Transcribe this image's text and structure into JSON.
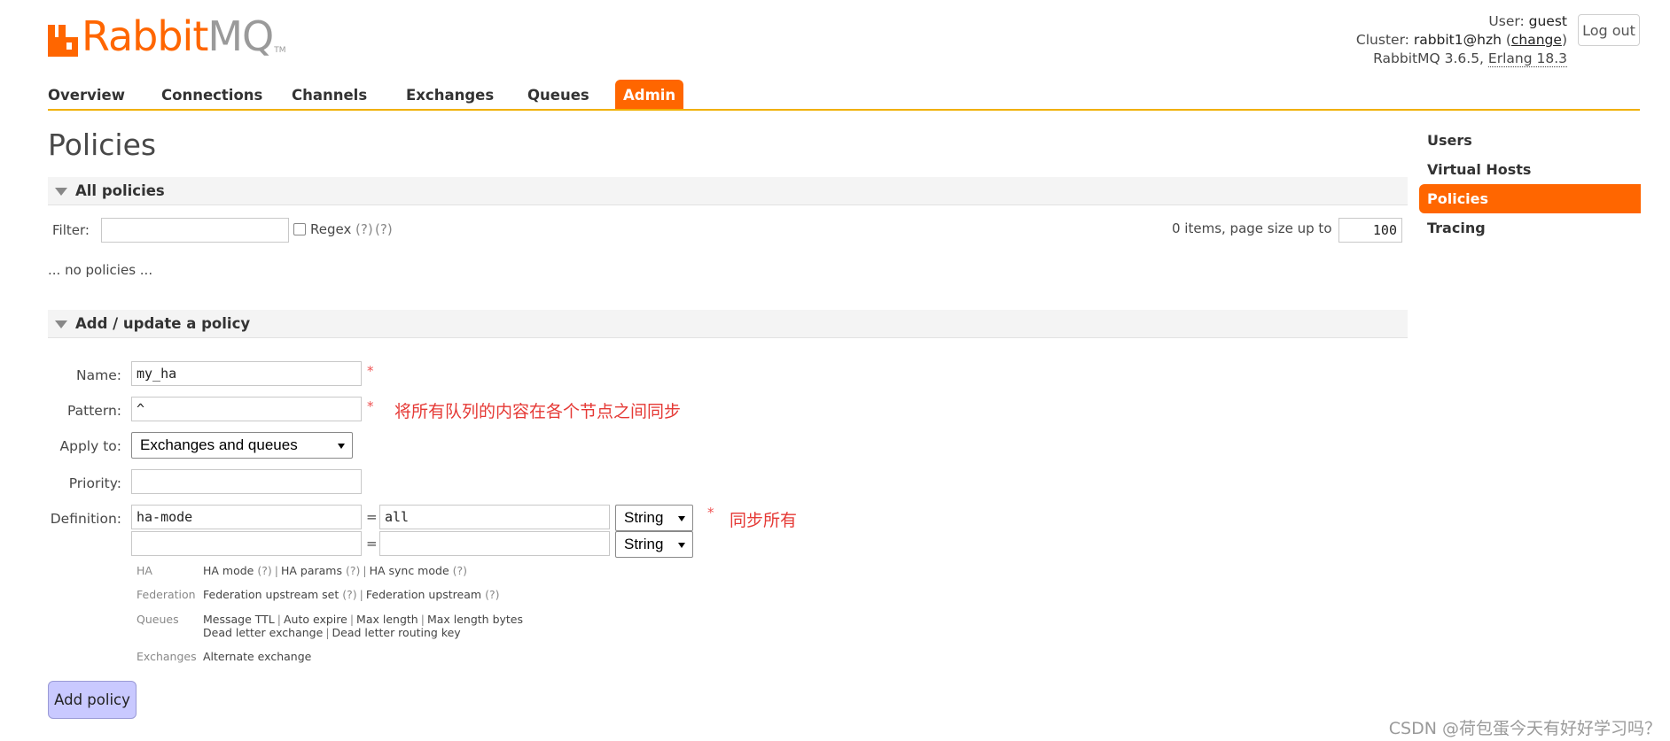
{
  "brand": {
    "name_part1": "Rabbit",
    "name_part2": "MQ",
    "trademark": "TM",
    "color_primary": "#ff6600",
    "color_secondary": "#9a9a9a"
  },
  "login": {
    "user_label": "User:",
    "user_value": "guest",
    "cluster_label": "Cluster:",
    "cluster_value": "rabbit1@hzh",
    "cluster_change_link": "change",
    "version_text": "RabbitMQ 3.6.5,",
    "erlang_link": "Erlang 18.3",
    "logout_label": "Log out"
  },
  "tabs": [
    {
      "label": "Overview",
      "active": false
    },
    {
      "label": "Connections",
      "active": false
    },
    {
      "label": "Channels",
      "active": false
    },
    {
      "label": "Exchanges",
      "active": false
    },
    {
      "label": "Queues",
      "active": false
    },
    {
      "label": "Admin",
      "active": true
    }
  ],
  "page": {
    "title": "Policies"
  },
  "all_policies": {
    "header": "All policies",
    "filter_label": "Filter:",
    "filter_value": "",
    "regex_label": "Regex",
    "regex_help1": "(?)",
    "regex_help2": "(?)",
    "items_text": "0 items, page size up to",
    "page_size": "100",
    "empty_text": "... no policies ..."
  },
  "add_policy": {
    "header": "Add / update a policy",
    "name_label": "Name:",
    "name_value": "my_ha",
    "pattern_label": "Pattern:",
    "pattern_value": "^",
    "pattern_note": "将所有队列的内容在各个节点之间同步",
    "apply_label": "Apply to:",
    "apply_selected": "Exchanges and queues",
    "priority_label": "Priority:",
    "priority_value": "",
    "definition_label": "Definition:",
    "definitions": [
      {
        "key": "ha-mode",
        "value": "all",
        "type": "String"
      },
      {
        "key": "",
        "value": "",
        "type": "String"
      }
    ],
    "definition_note": "同步所有",
    "required_mark": "*",
    "equals": "=",
    "hints": {
      "ha_cat": "HA",
      "ha_mode": "HA mode",
      "ha_params": "HA params",
      "ha_sync": "HA sync mode",
      "fed_cat": "Federation",
      "fed_set": "Federation upstream set",
      "fed_upstream": "Federation upstream",
      "queues_cat": "Queues",
      "q_ttl": "Message TTL",
      "q_expire": "Auto expire",
      "q_maxlen": "Max length",
      "q_maxbytes": "Max length bytes",
      "q_dlx": "Dead letter exchange",
      "q_dlrk": "Dead letter routing key",
      "ex_cat": "Exchanges",
      "ex_alt": "Alternate exchange",
      "help": "(?)",
      "sep": "|"
    },
    "submit_label": "Add policy"
  },
  "sidebar": [
    {
      "label": "Users",
      "active": false
    },
    {
      "label": "Virtual Hosts",
      "active": false
    },
    {
      "label": "Policies",
      "active": true
    },
    {
      "label": "Tracing",
      "active": false
    }
  ],
  "watermark": "CSDN @荷包蛋今天有好好学习吗？"
}
